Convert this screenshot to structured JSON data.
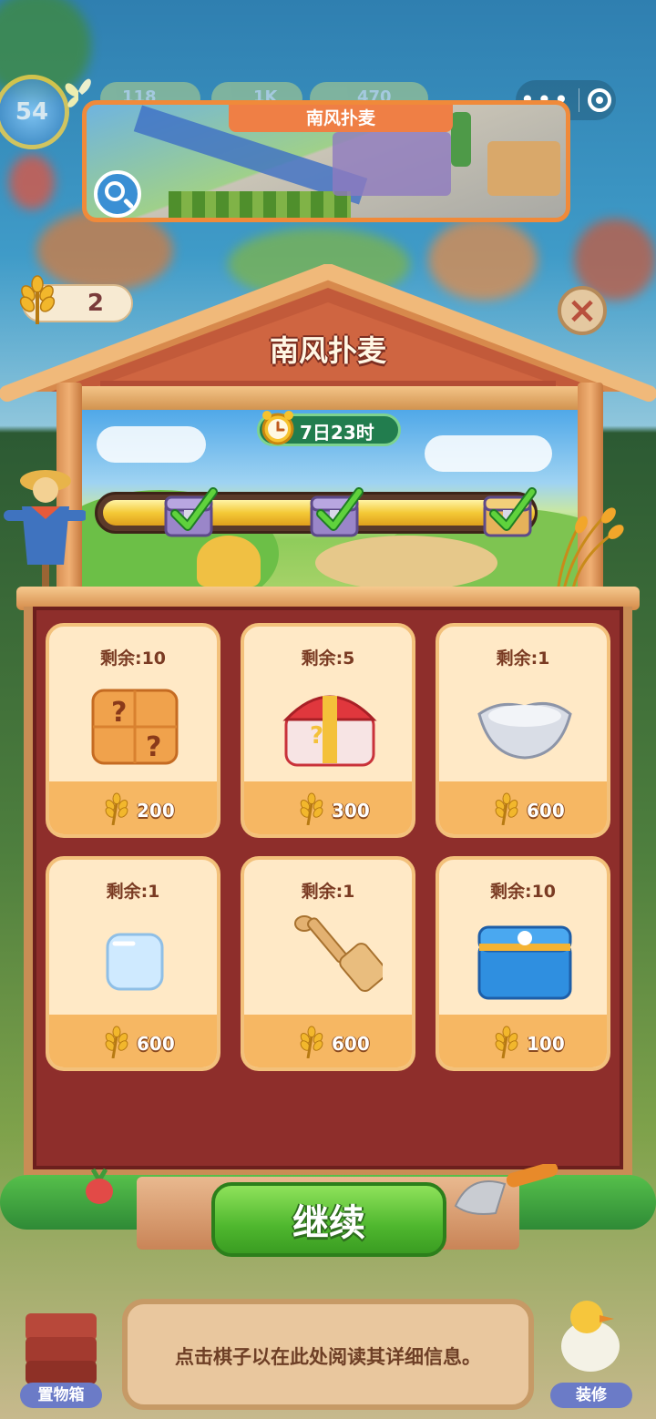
{
  "hud": {
    "level": "54",
    "stat1": "118",
    "stat2": "1K",
    "stat3": "470"
  },
  "event_preview": {
    "title": "南风扑麦"
  },
  "wheat_counter": {
    "value": "2"
  },
  "shop": {
    "title": "南风扑麦",
    "timer": "7日23时",
    "milestones_completed": 3,
    "milestones_total": 3,
    "progress_fraction": 1.0,
    "items": [
      {
        "remaining": "剩余:10",
        "price": "200",
        "icon": "mystery-box-icon"
      },
      {
        "remaining": "剩余:5",
        "price": "300",
        "icon": "mystery-chest-icon"
      },
      {
        "remaining": "剩余:1",
        "price": "600",
        "icon": "silver-bowl-icon"
      },
      {
        "remaining": "剩余:1",
        "price": "600",
        "icon": "ice-cube-icon"
      },
      {
        "remaining": "剩余:1",
        "price": "600",
        "icon": "wooden-spatula-icon"
      },
      {
        "remaining": "剩余:10",
        "price": "100",
        "icon": "blue-chest-icon"
      }
    ]
  },
  "continue_label": "继续",
  "info_text": "点击棋子以在此处阅读其详细信息。",
  "side_buttons": {
    "storage": "置物箱",
    "decorate": "装修"
  }
}
